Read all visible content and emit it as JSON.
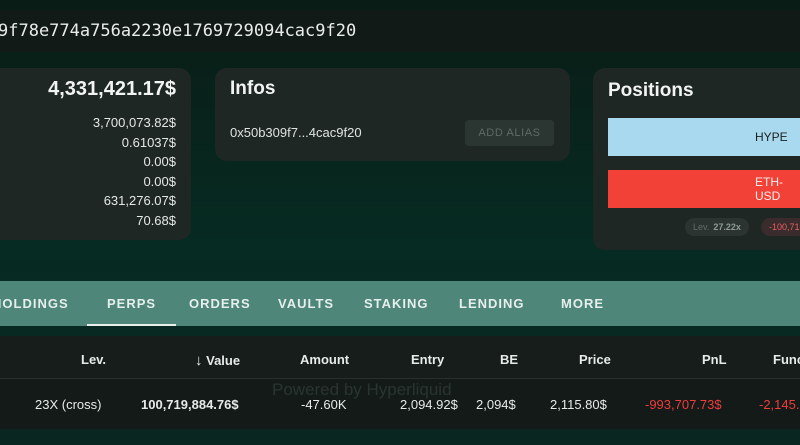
{
  "address": {
    "full": "9f78e774a756a2230e1769729094cac9f20"
  },
  "summary": {
    "total": "4,331,421.17$",
    "lines": [
      "3,700,073.82$",
      "0.61037$",
      "0.00$",
      "0.00$",
      "631,276.07$",
      "70.68$"
    ]
  },
  "infos": {
    "title": "Infos",
    "address_short": "0x50b309f7...4cac9f20",
    "add_alias_label": "ADD ALIAS"
  },
  "positions": {
    "title": "Positions",
    "items": [
      {
        "label": "HYPE",
        "color": "#a9d9ee"
      },
      {
        "label": "ETH-USD",
        "color": "#f24237"
      }
    ],
    "lev_label": "Lev.",
    "lev_value": "27.22x",
    "pnl_partial": "-100,71"
  },
  "tabs": [
    "HOLDINGS",
    "PERPS",
    "ORDERS",
    "VAULTS",
    "STAKING",
    "LENDING",
    "MORE"
  ],
  "active_tab": "PERPS",
  "table": {
    "headers": {
      "lev": "Lev.",
      "value": "Value",
      "amount": "Amount",
      "entry": "Entry",
      "be": "BE",
      "price": "Price",
      "pnl": "PnL",
      "funding": "Func"
    },
    "sort_arrow": "↓",
    "row": {
      "lev": "23X (cross)",
      "value": "100,719,884.76$",
      "amount": "-47.60K",
      "entry": "2,094.92$",
      "be": "2,094$",
      "price": "2,115.80$",
      "pnl": "-993,707.73$",
      "funding": "-2,145."
    }
  },
  "watermark": "Powered by Hyperliquid",
  "colors": {
    "accent_tabs": "#4e8679",
    "negative": "#ef3c3c",
    "long_bar": "#a9d9ee",
    "short_bar": "#f24237"
  }
}
